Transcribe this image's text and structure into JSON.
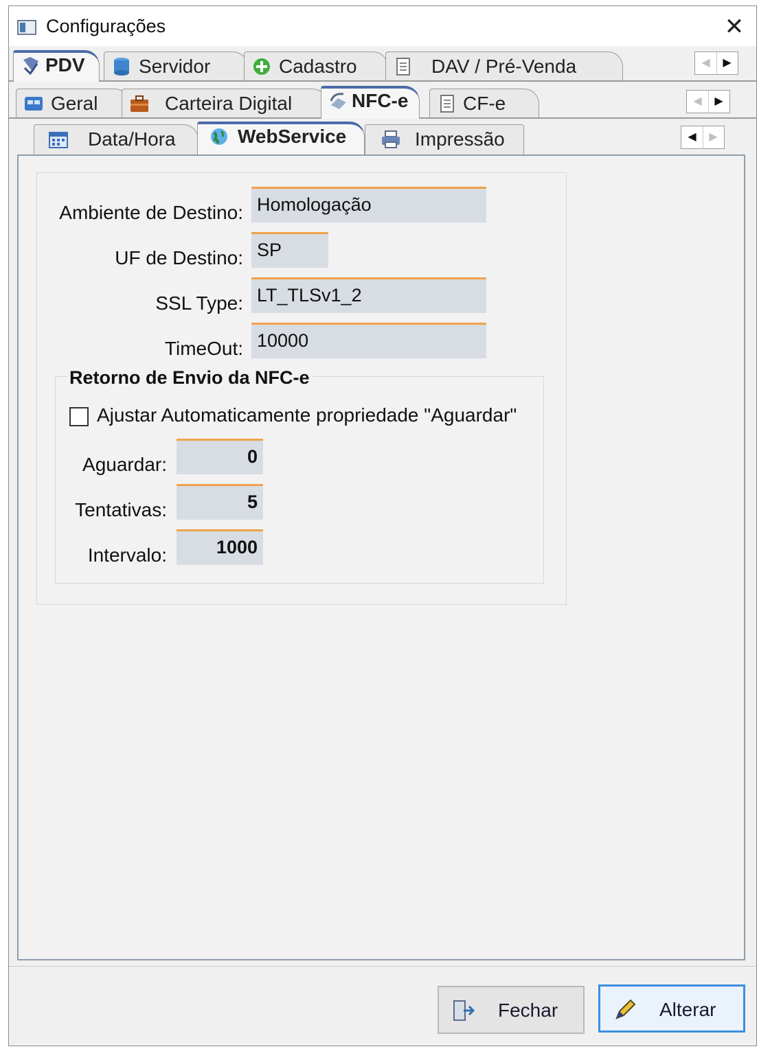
{
  "window": {
    "title": "Configurações",
    "close_glyph": "✕"
  },
  "tabs_level1": [
    {
      "label": "PDV",
      "icon": "pdv-icon",
      "active": true
    },
    {
      "label": "Servidor",
      "icon": "database-icon",
      "active": false
    },
    {
      "label": "Cadastro",
      "icon": "add-circle-icon",
      "active": false
    },
    {
      "label": "DAV / Pré-Venda",
      "icon": "document-icon",
      "active": false
    }
  ],
  "tabs_level2": [
    {
      "label": "Geral",
      "icon": "general-icon",
      "active": false
    },
    {
      "label": "Carteira Digital",
      "icon": "briefcase-icon",
      "active": false
    },
    {
      "label": "NFC-e",
      "icon": "nfce-icon",
      "active": true
    },
    {
      "label": "CF-e",
      "icon": "document-icon",
      "active": false
    }
  ],
  "tabs_level3": [
    {
      "label": "Data/Hora",
      "icon": "calendar-icon",
      "active": false
    },
    {
      "label": "WebService",
      "icon": "globe-icon",
      "active": true
    },
    {
      "label": "Impressão",
      "icon": "printer-icon",
      "active": false
    }
  ],
  "scroll": {
    "left_glyph": "◀",
    "right_glyph": "▶"
  },
  "form": {
    "ambiente_label": "Ambiente de Destino:",
    "ambiente_value": "Homologação",
    "uf_label": "UF de Destino:",
    "uf_value": "SP",
    "ssl_label": "SSL Type:",
    "ssl_value": "LT_TLSv1_2",
    "timeout_label": "TimeOut:",
    "timeout_value": "10000"
  },
  "retorno": {
    "title": "Retorno de Envio da NFC-e",
    "checkbox_label": "Ajustar Automaticamente propriedade \"Aguardar\"",
    "checkbox_checked": false,
    "aguardar_label": "Aguardar:",
    "aguardar_value": "0",
    "tentativas_label": "Tentativas:",
    "tentativas_value": "5",
    "intervalo_label": "Intervalo:",
    "intervalo_value": "1000"
  },
  "buttons": {
    "fechar": "Fechar",
    "alterar": "Alterar"
  },
  "colors": {
    "field_bg": "#d7dde3",
    "field_accent": "#f0a24a",
    "focus": "#3c8ee0"
  }
}
